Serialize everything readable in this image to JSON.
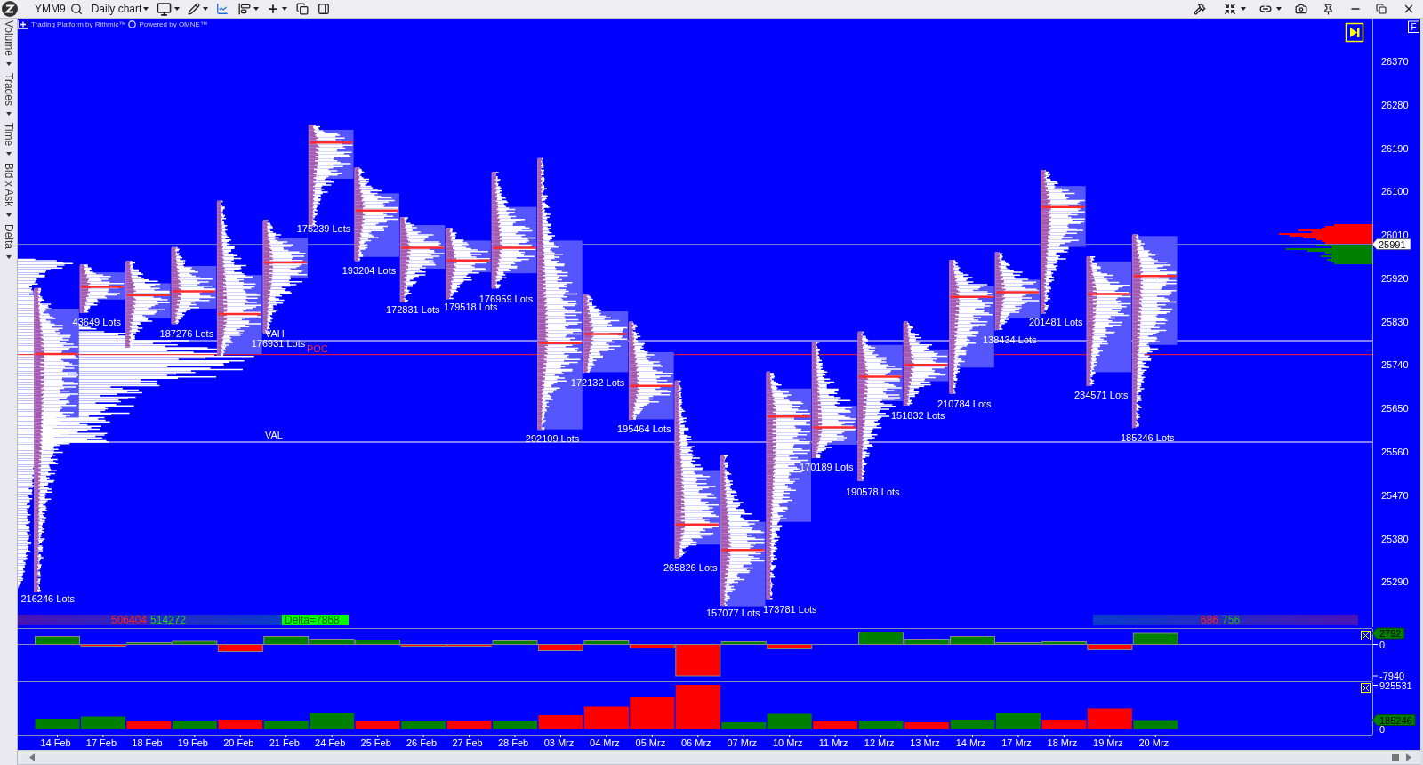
{
  "toolbar": {
    "symbol": "YMM9",
    "period": "Daily chart"
  },
  "side_tabs": [
    "Volume",
    "Trades",
    "Time",
    "Bid x Ask",
    "Delta"
  ],
  "chart": {
    "credits": [
      "Trading Platform by Rithmic™",
      "Powered by OMNE™"
    ],
    "scale_button": "F",
    "price_ticks": [
      "26370",
      "26280",
      "26190",
      "26100",
      "26010",
      "25920",
      "25830",
      "25740",
      "25650",
      "25560",
      "25470",
      "25380",
      "25290"
    ],
    "current_price": "25991",
    "value_area_labels": {
      "high": "VAH",
      "poc": "POC",
      "low": "VAL"
    },
    "lot_labels": [
      "216246 Lots",
      "43649 Lots",
      "187276 Lots",
      "176931 Lots",
      "175239 Lots",
      "193204 Lots",
      "172831 Lots",
      "179518 Lots",
      "176959 Lots",
      "292109 Lots",
      "172132 Lots",
      "195464 Lots",
      "265826 Lots",
      "157077 Lots",
      "173781 Lots",
      "170189 Lots",
      "190578 Lots",
      "151832 Lots",
      "210784 Lots",
      "138434 Lots",
      "201481 Lots",
      "234571 Lots",
      "185246 Lots"
    ],
    "summary_left": {
      "sell": "506404",
      "buy": "514272",
      "delta": "Delta=7868"
    },
    "summary_right": {
      "sell": "686",
      "buy": "756"
    }
  },
  "delta_pane": {
    "scale_labels": [
      "0",
      "-7940"
    ],
    "last_value": "2792"
  },
  "volume_pane": {
    "scale_labels": [
      "925531",
      "0"
    ],
    "last_value": "185246"
  },
  "date_axis": [
    "14 Feb",
    "17 Feb",
    "18 Feb",
    "19 Feb",
    "20 Feb",
    "21 Feb",
    "24 Feb",
    "25 Feb",
    "26 Feb",
    "27 Feb",
    "28 Feb",
    "03 Mrz",
    "04 Mrz",
    "05 Mrz",
    "06 Mrz",
    "07 Mrz",
    "10 Mrz",
    "11 Mrz",
    "12 Mrz",
    "13 Mrz",
    "14 Mrz",
    "17 Mrz",
    "18 Mrz",
    "19 Mrz",
    "20 Mrz"
  ]
}
